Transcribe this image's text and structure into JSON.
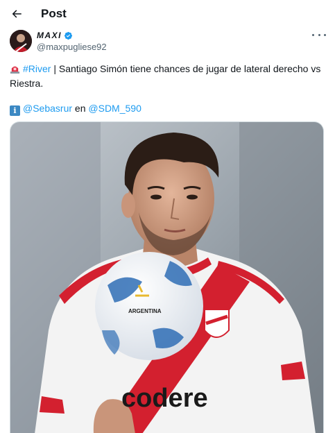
{
  "header": {
    "back_icon": "arrow-left-icon",
    "title": "Post"
  },
  "author": {
    "display_name": "MAXI",
    "handle": "@maxpugliese92",
    "verified": true,
    "verified_color": "#1d9bf0"
  },
  "tweet": {
    "line1_emoji": "police-light-emoji",
    "hashtag": "#River",
    "line1_text": " | Santiago Simón tiene chances de jugar de lateral derecho vs Riestra.",
    "line2_emoji": "information-emoji",
    "mention1": "@Sebasrur",
    "connector": " en ",
    "mention2": "@SDM_590"
  },
  "media": {
    "shirt_text": "codere",
    "ball_text": "ARGENTINA"
  },
  "colors": {
    "link": "#1d9bf0",
    "text": "#0f1419",
    "secondary": "#536471"
  }
}
